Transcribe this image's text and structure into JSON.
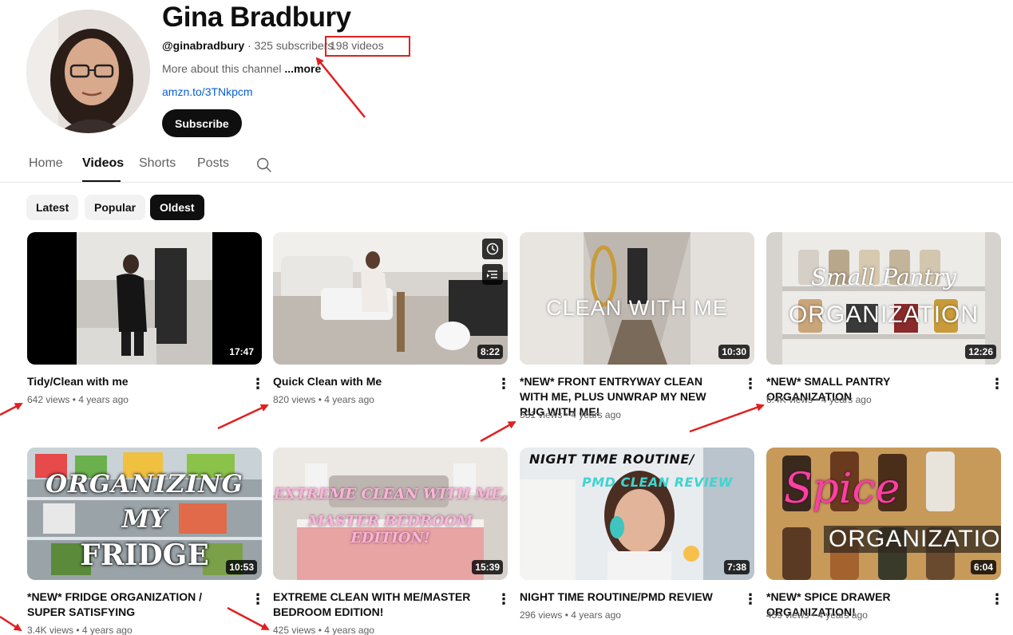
{
  "channel": {
    "name": "Gina Bradbury",
    "handle": "@ginabradbury",
    "separator": " · ",
    "subscribers": "325 subscribers",
    "video_count": "198 videos",
    "about_text": "More about this channel ",
    "about_more": "...more",
    "link": "amzn.to/3TNkpcm",
    "subscribe_label": "Subscribe"
  },
  "tabs": [
    {
      "label": "Home",
      "active": false
    },
    {
      "label": "Videos",
      "active": true
    },
    {
      "label": "Shorts",
      "active": false
    },
    {
      "label": "Posts",
      "active": false
    }
  ],
  "chips": [
    {
      "label": "Latest",
      "active": false
    },
    {
      "label": "Popular",
      "active": false
    },
    {
      "label": "Oldest",
      "active": true
    }
  ],
  "videos": [
    {
      "title": "Tidy/Clean with me",
      "duration": "17:47",
      "views": "642 views",
      "age": "4 years ago"
    },
    {
      "title": "Quick Clean with Me",
      "duration": "8:22",
      "views": "820 views",
      "age": "4 years ago"
    },
    {
      "title": "*NEW* FRONT ENTRYWAY CLEAN WITH ME, PLUS UNWRAP MY NEW RUG WITH ME!",
      "duration": "10:30",
      "views": "531 views",
      "age": "4 years ago",
      "thumb_text": "CLEAN WITH ME"
    },
    {
      "title": "*NEW* SMALL PANTRY ORGANIZATION",
      "duration": "12:26",
      "views": "6.4K views",
      "age": "4 years ago",
      "thumb_text_1": "Small Pantry",
      "thumb_text_2": "ORGANIZATION"
    },
    {
      "title": "*NEW* FRIDGE ORGANIZATION / SUPER SATISFYING",
      "duration": "10:53",
      "views": "3.4K views",
      "age": "4 years ago",
      "thumb_text_1": "ORGANIZING",
      "thumb_text_2": "MY",
      "thumb_text_3": "FRIDGE"
    },
    {
      "title": "EXTREME CLEAN WITH ME/MASTER BEDROOM EDITION!",
      "duration": "15:39",
      "views": "425 views",
      "age": "4 years ago",
      "thumb_text_1": "EXTREME CLEAN WITH ME,",
      "thumb_text_2": "MASTER BEDROOM EDITION!"
    },
    {
      "title": "NIGHT TIME ROUTINE/PMD REVIEW",
      "duration": "7:38",
      "views": "296 views",
      "age": "4 years ago",
      "thumb_text_1": "NIGHT TIME ROUTINE/",
      "thumb_text_2": "PMD CLEAN REVIEW"
    },
    {
      "title": "*NEW* SPICE DRAWER ORGANIZATION!",
      "duration": "6:04",
      "views": "459 views",
      "age": "4 years ago",
      "thumb_text_1": "Spice",
      "thumb_text_2": "ORGANIZATION"
    }
  ],
  "stats_separator": " • ",
  "icons": {
    "search": "search-icon",
    "kebab": "more-vert-icon",
    "watch_later": "clock-icon",
    "add_to_queue": "queue-icon"
  },
  "colors": {
    "accent_link": "#065fd4",
    "annotation_red": "#e02020",
    "subscribe_bg": "#0f0f0f"
  }
}
